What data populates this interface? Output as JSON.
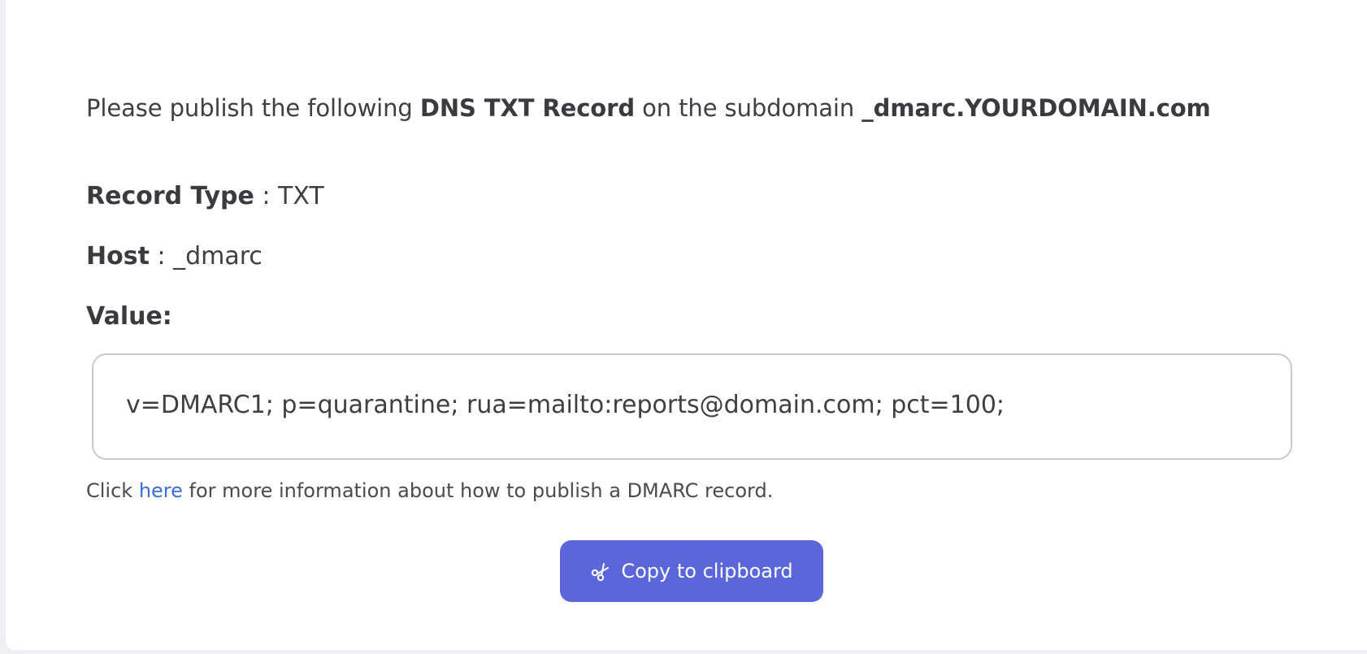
{
  "instructions": {
    "prefix": "Please publish the following ",
    "record_label": "DNS TXT Record",
    "middle": " on the subdomain ",
    "subdomain": "_dmarc.YOURDOMAIN.com"
  },
  "record": {
    "type_label": "Record Type",
    "separator": " : ",
    "type_value": "TXT",
    "host_label": "Host",
    "host_value": "_dmarc",
    "value_label": "Value:",
    "value_text": "v=DMARC1; p=quarantine; rua=mailto:reports@domain.com; pct=100;"
  },
  "help": {
    "prefix": "Click ",
    "link_text": "here",
    "suffix": " for more information about how to publish a DMARC record."
  },
  "copy_button": {
    "label": "Copy to clipboard",
    "icon": "scissors-icon"
  },
  "colors": {
    "button": "#5b66db",
    "link": "#3a6fd8",
    "text": "#3e3e44",
    "border": "#c9c9cc"
  }
}
